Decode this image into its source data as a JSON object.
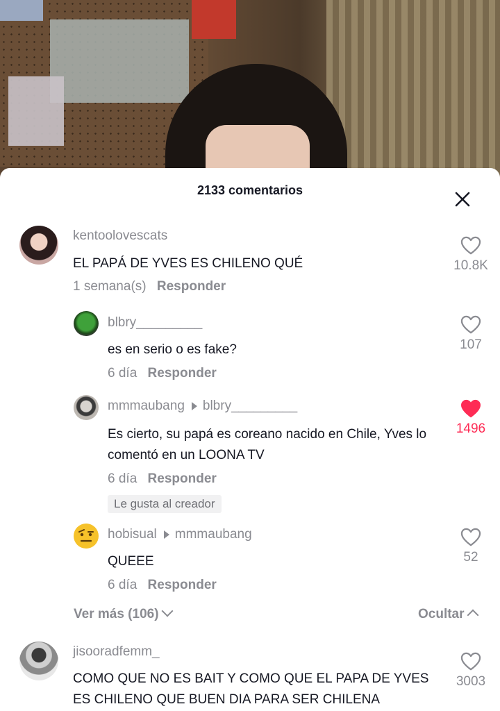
{
  "sheet": {
    "title": "2133 comentarios"
  },
  "colors": {
    "like_active": "#fe2c55",
    "secondary_text": "#8a8b91",
    "primary_text": "#161823"
  },
  "comments": [
    {
      "username": "kentoolovescats",
      "text": "EL PAPÁ DE YVES ES CHILENO QUÉ",
      "time": "1 semana(s)",
      "reply_label": "Responder",
      "likes": "10.8K",
      "liked": false
    },
    {
      "username": "jisooradfemm_",
      "text": "COMO QUE NO ES BAIT Y COMO QUE EL PAPA DE YVES ES CHILENO QUE BUEN DIA PARA SER CHILENA",
      "likes": "3003",
      "liked": false
    }
  ],
  "replies": [
    {
      "username": "blbry_________",
      "reply_to": "",
      "text": "es en serio o es fake?",
      "time": "6 día",
      "reply_label": "Responder",
      "likes": "107",
      "liked": false
    },
    {
      "username": "mmmaubang",
      "reply_to": "blbry_________",
      "text": "Es cierto, su papá es coreano nacido en Chile, Yves lo comentó en un LOONA TV",
      "time": "6 día",
      "reply_label": "Responder",
      "likes": "1496",
      "liked": true,
      "badge": "Le gusta al creador"
    },
    {
      "username": "hobisual",
      "reply_to": "mmmaubang",
      "text": "QUEEE",
      "time": "6 día",
      "reply_label": "Responder",
      "likes": "52",
      "liked": false
    }
  ],
  "thread_controls": {
    "view_more": "Ver más (106)",
    "hide": "Ocultar"
  }
}
